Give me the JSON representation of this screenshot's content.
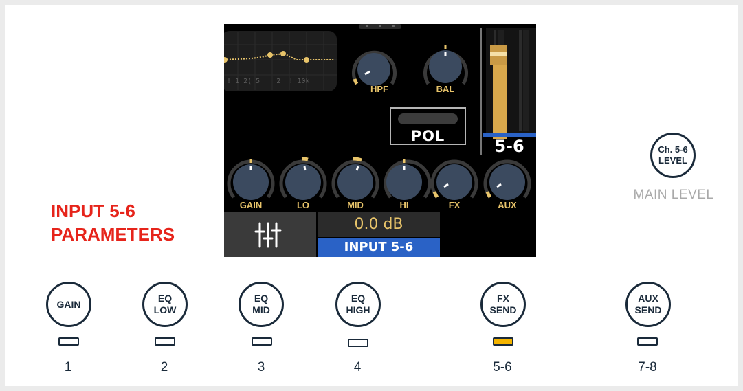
{
  "screen": {
    "eq_tick_labels": "! 1 2( 5    2  ! 10k",
    "knob_labels_top": [
      "HPF",
      "BAL"
    ],
    "pol_label": "POL",
    "channel_name": "5-6",
    "knob_labels_bottom": [
      "GAIN",
      "LO",
      "MID",
      "HI",
      "FX",
      "AUX"
    ],
    "level_readout": "0.0 dB",
    "input_name": "INPUT 5-6",
    "mixer_icon": "faders-icon"
  },
  "section_title": [
    "INPUT 5-6",
    "PARAMETERS"
  ],
  "main": {
    "button_label_line1": "Ch. 5-6",
    "button_label_line2": "LEVEL",
    "caption": "MAIN LEVEL"
  },
  "parameter_buttons": [
    {
      "line1": "GAIN",
      "line2": "",
      "led_on": false,
      "number": "1"
    },
    {
      "line1": "EQ",
      "line2": "LOW",
      "led_on": false,
      "number": "2"
    },
    {
      "line1": "EQ",
      "line2": "MID",
      "led_on": false,
      "number": "3"
    },
    {
      "line1": "EQ",
      "line2": "HIGH",
      "led_on": false,
      "number": "4"
    },
    {
      "line1": "FX",
      "line2": "SEND",
      "led_on": true,
      "number": "5-6"
    },
    {
      "line1": "AUX",
      "line2": "SEND",
      "led_on": false,
      "number": "7-8"
    }
  ],
  "colors": {
    "title_red": "#e6241b",
    "lcd_accent": "#e8c46a",
    "input_blue": "#2a62c6",
    "led_on": "#f4b400",
    "outline": "#1a2a3a"
  }
}
